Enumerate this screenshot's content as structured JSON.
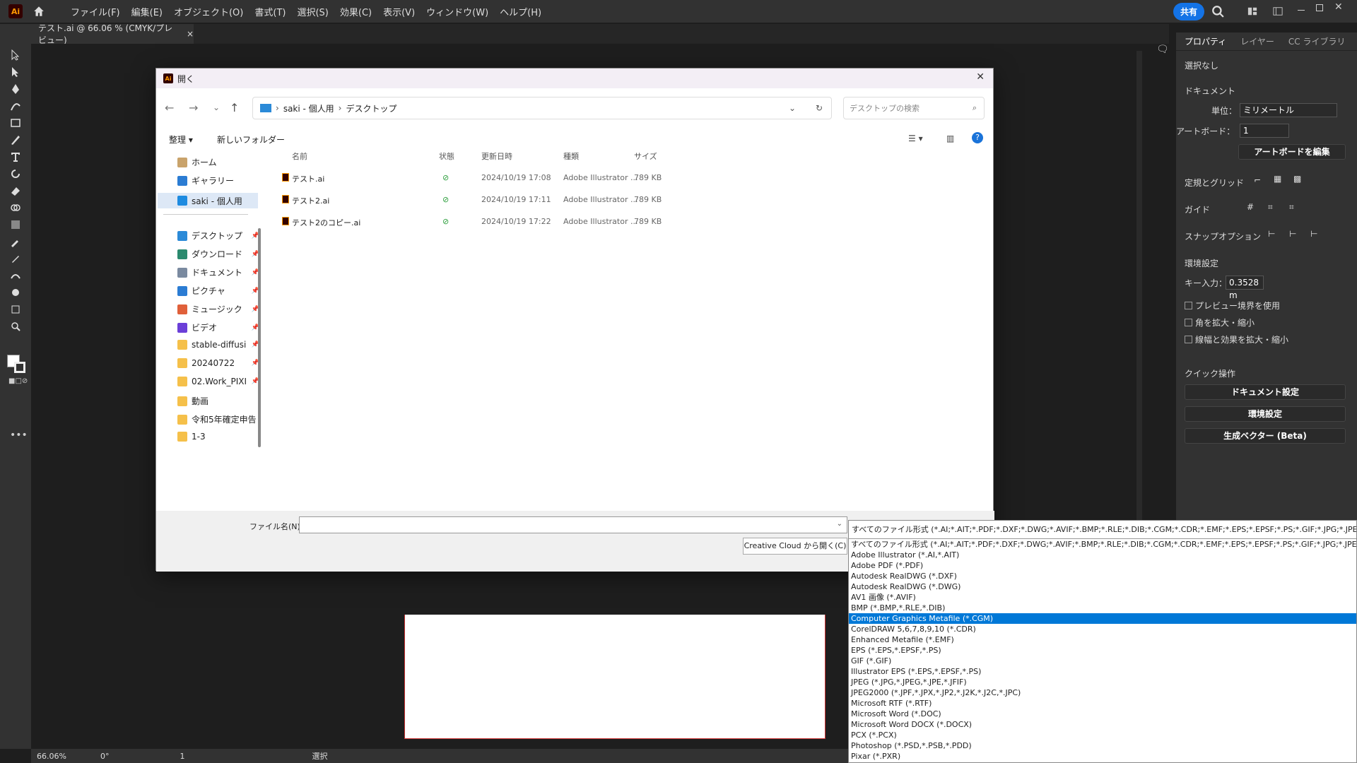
{
  "menubar": {
    "logo": "Ai",
    "items": [
      "ファイル(F)",
      "編集(E)",
      "オブジェクト(O)",
      "書式(T)",
      "選択(S)",
      "効果(C)",
      "表示(V)",
      "ウィンドウ(W)",
      "ヘルプ(H)"
    ],
    "share": "共有"
  },
  "tab": {
    "title": "テスト.ai @ 66.06 % (CMYK/プレビュー)",
    "close": "×"
  },
  "statusbar": {
    "zoom": "66.06%",
    "rotation": "0°",
    "artboard": "1",
    "mode": "選択"
  },
  "panel": {
    "tabs": [
      "プロパティ",
      "レイヤー",
      "CC ライブラリ"
    ],
    "selection": "選択なし",
    "document": "ドキュメント",
    "unit_label": "単位：",
    "unit_value": "ミリメートル",
    "artboard_label": "アートボード：",
    "artboard_value": "1",
    "edit_artboard": "アートボードを編集",
    "rulers_grid": "定規とグリッド",
    "guides": "ガイド",
    "snap": "スナップオプション",
    "prefs": "環境設定",
    "key_input_label": "キー入力：",
    "key_input_value": "0.3528 m",
    "checks": [
      "プレビュー境界を使用",
      "角を拡大・縮小",
      "線幅と効果を拡大・縮小"
    ],
    "quick": "クイック操作",
    "quick_buttons": [
      "ドキュメント設定",
      "環境設定",
      "生成ベクター (Beta)"
    ]
  },
  "dialog": {
    "title": "開く",
    "path": [
      "saki - 個人用",
      "デスクトップ"
    ],
    "search_placeholder": "デスクトップの検索",
    "organize": "整理 ▾",
    "new_folder": "新しいフォルダー",
    "sidebar": [
      {
        "label": "ホーム",
        "color": "#c9a36b"
      },
      {
        "label": "ギャラリー",
        "color": "#2b7cd3"
      },
      {
        "label": "saki - 個人用",
        "color": "#1e8be0"
      },
      {
        "label": "デスクトップ",
        "color": "#2b8ad8"
      },
      {
        "label": "ダウンロード",
        "color": "#2b8a6e"
      },
      {
        "label": "ドキュメント",
        "color": "#7a8aa0"
      },
      {
        "label": "ピクチャ",
        "color": "#2b7cd3"
      },
      {
        "label": "ミュージック",
        "color": "#e0603a"
      },
      {
        "label": "ビデオ",
        "color": "#6b3fd8"
      },
      {
        "label": "stable-diffusi",
        "color": "#f5c04a"
      },
      {
        "label": "20240722",
        "color": "#f5c04a"
      },
      {
        "label": "02.Work_PIXI",
        "color": "#f5c04a"
      },
      {
        "label": "動画",
        "color": "#f5c04a"
      },
      {
        "label": "令和5年確定申告",
        "color": "#f5c04a"
      },
      {
        "label": "1-3",
        "color": "#f5c04a"
      }
    ],
    "columns": [
      "名前",
      "状態",
      "更新日時",
      "種類",
      "サイズ"
    ],
    "files": [
      {
        "name": "テスト.ai",
        "date": "2024/10/19 17:08",
        "type": "Adobe Illustrator ...",
        "size": "789 KB"
      },
      {
        "name": "テスト2.ai",
        "date": "2024/10/19 17:11",
        "type": "Adobe Illustrator ...",
        "size": "789 KB"
      },
      {
        "name": "テスト2のコピー.ai",
        "date": "2024/10/19 17:22",
        "type": "Adobe Illustrator ...",
        "size": "789 KB"
      }
    ],
    "filename_label": "ファイル名(N):",
    "filename_value": "",
    "cc_open": "Creative Cloud から開く(C)"
  },
  "filetype": {
    "current": "すべてのファイル形式 (*.AI;*.AIT;*.PDF;*.DXF;*.DWG;*.AVIF;*.BMP;*.RLE;*.DIB;*.CGM;*.CDR;*.EMF;*.EPS;*.EPSF;*.PS;*.GIF;*.JPG;*.JPEG;*.JFIF;*.J",
    "selected_index": 7,
    "options": [
      "すべてのファイル形式 (*.AI;*.AIT;*.PDF;*.DXF;*.DWG;*.AVIF;*.BMP;*.RLE;*.DIB;*.CGM;*.CDR;*.EMF;*.EPS;*.EPSF;*.PS;*.GIF;*.JPG;*.JPEG;*.JFIF;*.J",
      "Adobe Illustrator (*.AI,*.AIT)",
      "Adobe PDF (*.PDF)",
      "Autodesk RealDWG (*.DXF)",
      "Autodesk RealDWG (*.DWG)",
      "AV1 画像 (*.AVIF)",
      "BMP (*.BMP,*.RLE,*.DIB)",
      "Computer Graphics Metafile (*.CGM)",
      "CorelDRAW 5,6,7,8,9,10 (*.CDR)",
      "Enhanced Metafile (*.EMF)",
      "EPS (*.EPS,*.EPSF,*.PS)",
      "GIF (*.GIF)",
      "Illustrator EPS (*.EPS,*.EPSF,*.PS)",
      "JPEG (*.JPG,*.JPEG,*.JPE,*.JFIF)",
      "JPEG2000 (*.JPF,*.JPX,*.JP2,*.J2K,*.J2C,*.JPC)",
      "Microsoft RTF (*.RTF)",
      "Microsoft Word (*.DOC)",
      "Microsoft Word DOCX (*.DOCX)",
      "PCX (*.PCX)",
      "Photoshop (*.PSD,*.PSB,*.PDD)",
      "Pixar (*.PXR)"
    ]
  }
}
